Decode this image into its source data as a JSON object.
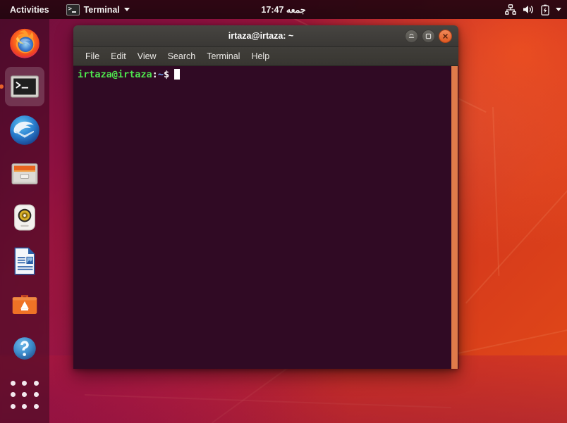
{
  "topbar": {
    "activities_label": "Activities",
    "app_name": "Terminal",
    "app_icon": "terminal-icon",
    "clock": "جمعه 17:47",
    "tray": [
      {
        "name": "network-icon",
        "label": "Network"
      },
      {
        "name": "volume-icon",
        "label": "Volume"
      },
      {
        "name": "battery-charging-icon",
        "label": "Battery charging"
      },
      {
        "name": "system-menu-caret-icon",
        "label": "System menu"
      }
    ]
  },
  "dock": {
    "items": [
      {
        "name": "firefox",
        "label": "Firefox Web Browser",
        "active": false
      },
      {
        "name": "terminal",
        "label": "Terminal",
        "active": true
      },
      {
        "name": "thunderbird",
        "label": "Thunderbird Mail",
        "active": false
      },
      {
        "name": "files",
        "label": "Files",
        "active": false
      },
      {
        "name": "rhythmbox",
        "label": "Rhythmbox",
        "active": false
      },
      {
        "name": "libreoffice-writer",
        "label": "LibreOffice Writer",
        "active": false
      },
      {
        "name": "ubuntu-software",
        "label": "Ubuntu Software",
        "active": false
      },
      {
        "name": "help",
        "label": "Help",
        "active": false
      }
    ],
    "show_apps_label": "Show Applications"
  },
  "terminal": {
    "title": "irtaza@irtaza: ~",
    "window_buttons": [
      {
        "name": "minimize-button",
        "label": "Minimize"
      },
      {
        "name": "maximize-button",
        "label": "Maximize"
      },
      {
        "name": "close-button",
        "label": "Close"
      }
    ],
    "menu": [
      {
        "label": "File"
      },
      {
        "label": "Edit"
      },
      {
        "label": "View"
      },
      {
        "label": "Search"
      },
      {
        "label": "Terminal"
      },
      {
        "label": "Help"
      }
    ],
    "prompt": {
      "user_host": "irtaza@irtaza",
      "colon": ":",
      "path": "~",
      "symbol": "$",
      "command": ""
    }
  },
  "colors": {
    "terminal_bg": "#300a24",
    "terminal_titlebar": "#3c3a36",
    "prompt_green": "#4ee44e",
    "prompt_blue": "#6d9fee",
    "accent_orange": "#e8622a",
    "scrollbar": "#e07b4a",
    "topbar_bg": "#2d0b1d"
  }
}
